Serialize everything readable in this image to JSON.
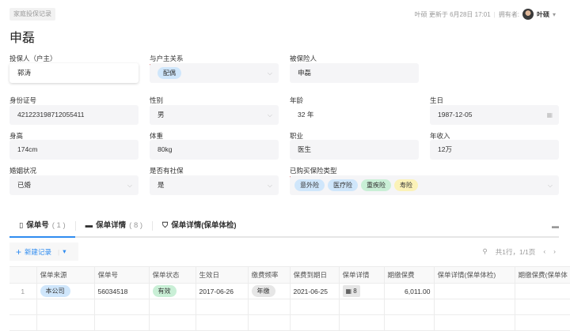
{
  "breadcrumb": "家庭投保记录",
  "meta": {
    "updated": "叶硕 更新于 6月28日 17:01",
    "owner_label": "拥有者:",
    "owner": "叶硕"
  },
  "title": "申磊",
  "fields": {
    "policyholder": {
      "label": "投保人（户主）",
      "value": "郭涛"
    },
    "relation": {
      "label": "与户主关系",
      "value": "配偶"
    },
    "insured": {
      "label": "被保险人",
      "value": "申磊"
    },
    "id": {
      "label": "身份证号",
      "value": "421223198712055411"
    },
    "gender": {
      "label": "性别",
      "value": "男"
    },
    "age": {
      "label": "年龄",
      "value": "32 年"
    },
    "birthday": {
      "label": "生日",
      "value": "1987-12-05"
    },
    "height": {
      "label": "身高",
      "value": "174cm"
    },
    "weight": {
      "label": "体重",
      "value": "80kg"
    },
    "job": {
      "label": "职业",
      "value": "医生"
    },
    "income": {
      "label": "年收入",
      "value": "12万"
    },
    "marital": {
      "label": "婚姻状况",
      "value": "已婚"
    },
    "social": {
      "label": "是否有社保",
      "value": "是"
    },
    "types": {
      "label": "已购买保险类型",
      "values": [
        "意外险",
        "医疗险",
        "重疾险",
        "寿险"
      ]
    }
  },
  "tabs": [
    {
      "label": "保单号",
      "count": "( 1 )"
    },
    {
      "label": "保单详情",
      "count": "( 8 )"
    },
    {
      "label": "保单详情(保单体检)"
    }
  ],
  "toolbar": {
    "new": "新建记录",
    "pagination": "共1行，1/1页"
  },
  "table": {
    "headers": [
      "",
      "保单来源",
      "保单号",
      "保单状态",
      "生效日",
      "缴费频率",
      "保费到期日",
      "保单详情",
      "期缴保费",
      "保单详情(保单体检)",
      "期缴保费(保单体"
    ],
    "rows": [
      [
        "1",
        "本公司",
        "56034518",
        "有效",
        "2017-06-26",
        "年缴",
        "2021-06-25",
        "8",
        "6,011.00",
        "",
        ""
      ]
    ]
  }
}
